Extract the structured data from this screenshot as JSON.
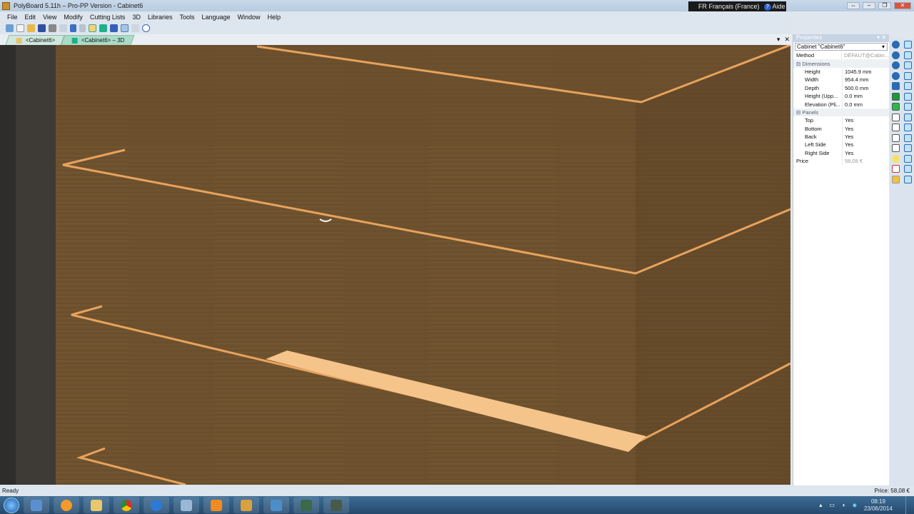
{
  "window": {
    "title": "PolyBoard 5.11h – Pro-PP Version - Cabinet6",
    "language": "FR Français (France)",
    "help": "Aide"
  },
  "menu": [
    "File",
    "Edit",
    "View",
    "Modify",
    "Cutting Lists",
    "3D",
    "Libraries",
    "Tools",
    "Language",
    "Window",
    "Help"
  ],
  "tabs": [
    {
      "label": "<Cabinet6>"
    },
    {
      "label": "<Cabinet6> – 3D"
    }
  ],
  "properties": {
    "title": "Properties",
    "selector": "Cabinet \"Cabinet6\"",
    "method": {
      "label": "Method",
      "value": "DÉFAUT@Cabin..."
    },
    "dimensions_label": "Dimensions",
    "dimensions": [
      {
        "label": "Height",
        "value": "1045.9 mm"
      },
      {
        "label": "Width",
        "value": "954.4 mm"
      },
      {
        "label": "Depth",
        "value": "500.0 mm"
      },
      {
        "label": "Height (Upp...",
        "value": "0.0 mm"
      },
      {
        "label": "Elevation (Pli...",
        "value": "0.0 mm"
      }
    ],
    "panels_label": "Panels",
    "panels": [
      {
        "label": "Top",
        "value": "Yes"
      },
      {
        "label": "Bottom",
        "value": "Yes"
      },
      {
        "label": "Back",
        "value": "Yes"
      },
      {
        "label": "Left Side",
        "value": "Yes"
      },
      {
        "label": "Right Side",
        "value": "Yes"
      }
    ],
    "price": {
      "label": "Price",
      "value": "58,08 €"
    }
  },
  "status": {
    "left": "Ready",
    "right": "Price: 58,08 €"
  },
  "clock": {
    "time": "08:19",
    "date": "23/06/2014"
  },
  "colors": {
    "wood": "#6b4f2c",
    "edge": "#e8a35c",
    "highlight": "#f5c48a"
  }
}
